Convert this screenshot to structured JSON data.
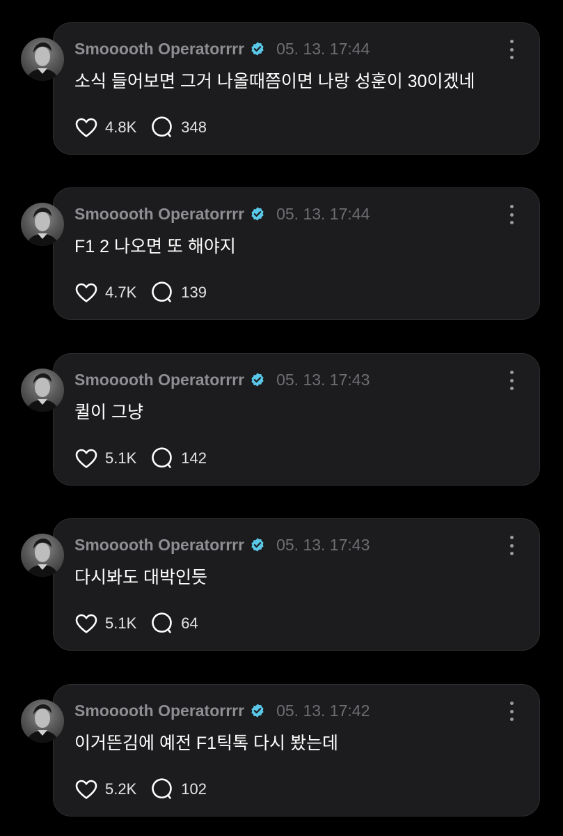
{
  "colors": {
    "background": "#000000",
    "card": "#1c1c1e",
    "card_border": "#2e2e30",
    "username": "#8e8e93",
    "timestamp": "#6e6e73",
    "verified": "#5ac8e8"
  },
  "posts": [
    {
      "username": "Smooooth Operatorrrr",
      "timestamp": "05. 13. 17:44",
      "text": "소식 들어보면 그거 나올때쯤이면 나랑 성훈이 30이겠네",
      "likes": "4.8K",
      "comments": "348"
    },
    {
      "username": "Smooooth Operatorrrr",
      "timestamp": "05. 13. 17:44",
      "text": "F1 2 나오면 또 해야지",
      "likes": "4.7K",
      "comments": "139"
    },
    {
      "username": "Smooooth Operatorrrr",
      "timestamp": "05. 13. 17:43",
      "text": "퀼이 그냥",
      "likes": "5.1K",
      "comments": "142"
    },
    {
      "username": "Smooooth Operatorrrr",
      "timestamp": "05. 13. 17:43",
      "text": "다시봐도 대박인듯",
      "likes": "5.1K",
      "comments": "64"
    },
    {
      "username": "Smooooth Operatorrrr",
      "timestamp": "05. 13. 17:42",
      "text": "이거뜬김에 예전 F1틱톡 다시 봤는데",
      "likes": "5.2K",
      "comments": "102"
    }
  ],
  "icons": {
    "more": "more-vertical-icon",
    "like": "heart-icon",
    "comment": "comment-bubble-icon",
    "verified": "verified-badge-icon"
  }
}
